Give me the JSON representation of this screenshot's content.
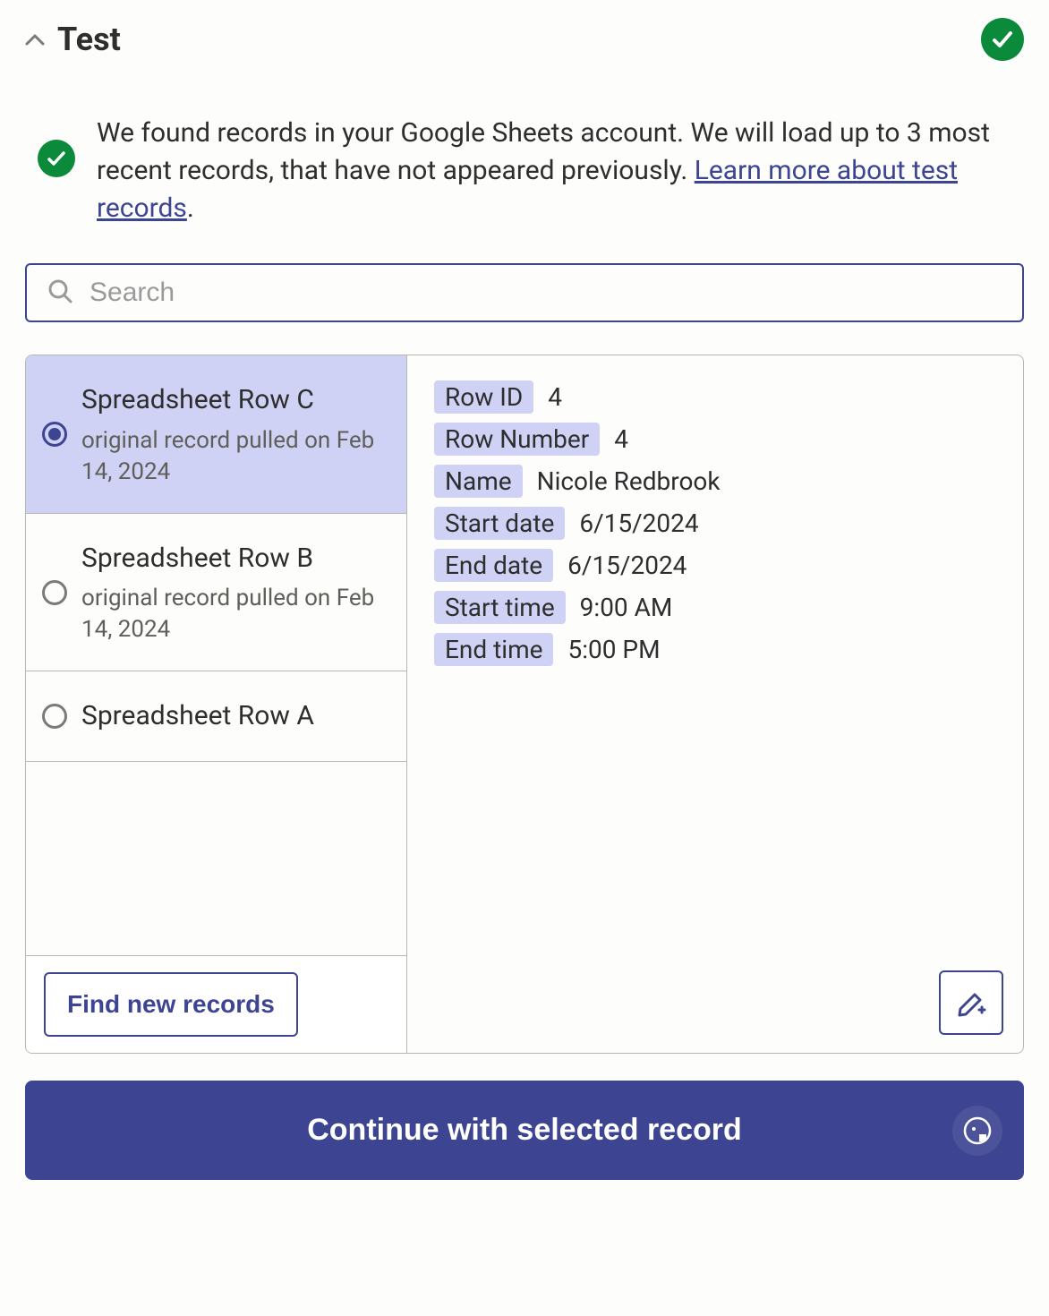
{
  "header": {
    "title": "Test"
  },
  "info": {
    "text_part1": "We found records in your Google Sheets account. We will load up to 3 most recent records, that have not appeared previously. ",
    "link_text": "Learn more about test records",
    "text_part2": "."
  },
  "search": {
    "placeholder": "Search"
  },
  "records": [
    {
      "title": "Spreadsheet Row C",
      "subtitle": "original record pulled on Feb 14, 2024",
      "selected": true
    },
    {
      "title": "Spreadsheet Row B",
      "subtitle": "original record pulled on Feb 14, 2024",
      "selected": false
    },
    {
      "title": "Spreadsheet Row A",
      "subtitle": "",
      "selected": false
    }
  ],
  "find_button": "Find new records",
  "detail_fields": [
    {
      "label": "Row ID",
      "value": "4"
    },
    {
      "label": "Row Number",
      "value": "4"
    },
    {
      "label": "Name",
      "value": "Nicole Redbrook"
    },
    {
      "label": "Start date",
      "value": "6/15/2024"
    },
    {
      "label": "End date",
      "value": "6/15/2024"
    },
    {
      "label": "Start time",
      "value": "9:00 AM"
    },
    {
      "label": "End time",
      "value": "5:00 PM"
    }
  ],
  "continue_button": "Continue with selected record"
}
